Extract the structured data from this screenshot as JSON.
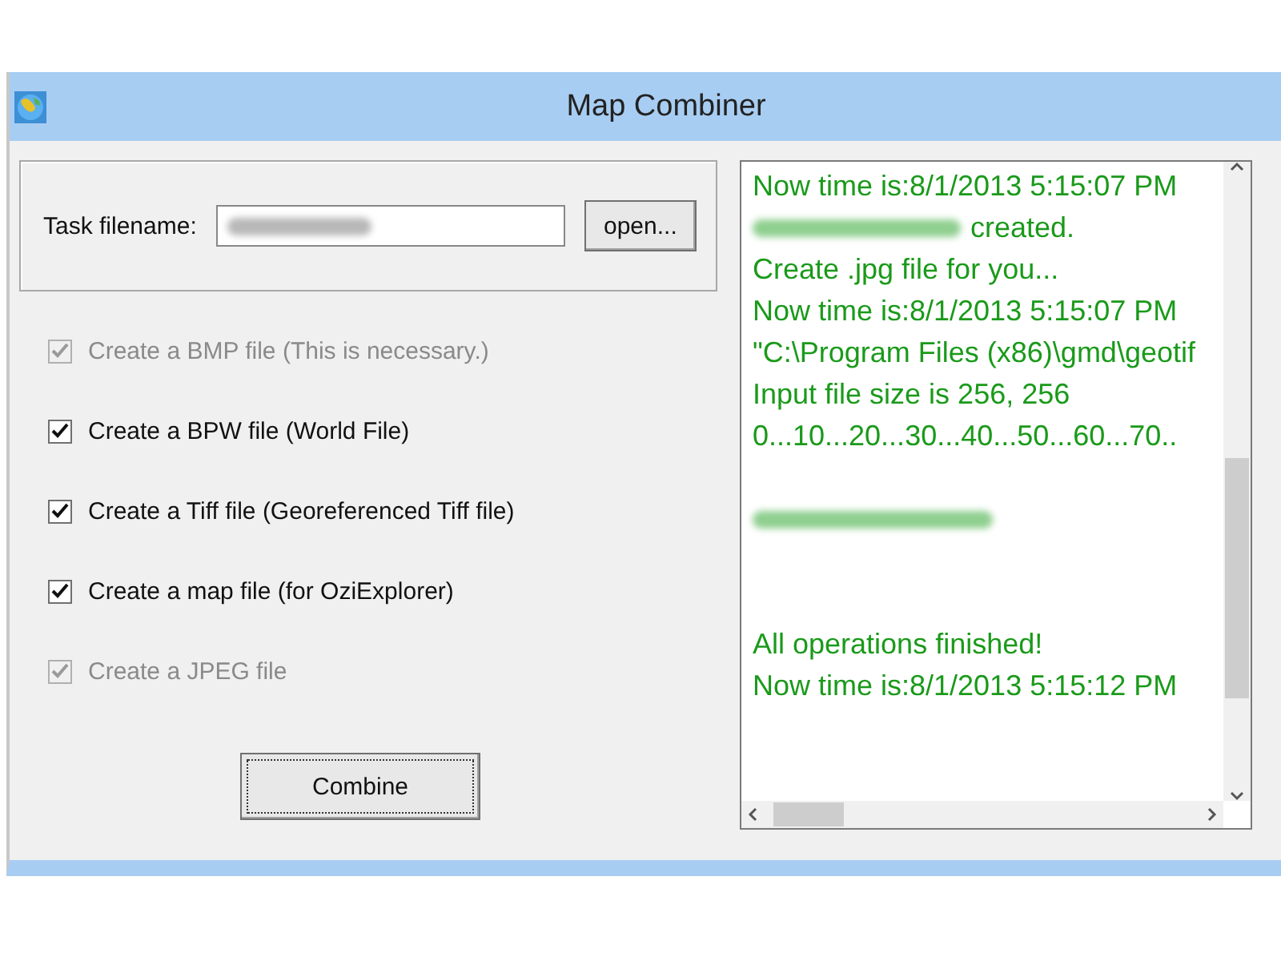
{
  "window": {
    "title": "Map Combiner"
  },
  "task": {
    "label": "Task filename:",
    "value_redacted": true,
    "open_button": "open..."
  },
  "options": [
    {
      "label": "Create a BMP file (This is necessary.)",
      "checked": true,
      "disabled": true
    },
    {
      "label": "Create a BPW file (World File)",
      "checked": true,
      "disabled": false
    },
    {
      "label": "Create a Tiff file (Georeferenced Tiff file)",
      "checked": true,
      "disabled": false
    },
    {
      "label": "Create a map file (for OziExplorer)",
      "checked": true,
      "disabled": false
    },
    {
      "label": "Create a JPEG file",
      "checked": true,
      "disabled": true
    }
  ],
  "combine_button": "Combine",
  "log": [
    {
      "kind": "text",
      "redacted": false,
      "text": "Now time is:8/1/2013 5:15:07 PM"
    },
    {
      "kind": "text",
      "redacted": true,
      "text": "created."
    },
    {
      "kind": "text",
      "redacted": false,
      "text": "Create .jpg file for you..."
    },
    {
      "kind": "text",
      "redacted": false,
      "text": "Now time is:8/1/2013 5:15:07 PM"
    },
    {
      "kind": "text",
      "redacted": false,
      "text": "\"C:\\Program Files (x86)\\gmd\\geotif"
    },
    {
      "kind": "text",
      "redacted": false,
      "text": "Input file size is 256, 256"
    },
    {
      "kind": "text",
      "redacted": false,
      "text": "0...10...20...30...40...50...60...70.."
    },
    {
      "kind": "blank"
    },
    {
      "kind": "text",
      "redacted": true
    },
    {
      "kind": "blank"
    },
    {
      "kind": "blank"
    },
    {
      "kind": "text",
      "redacted": false,
      "text": "All operations finished!"
    },
    {
      "kind": "text",
      "redacted": false,
      "text": "Now time is:8/1/2013 5:15:12 PM"
    }
  ]
}
